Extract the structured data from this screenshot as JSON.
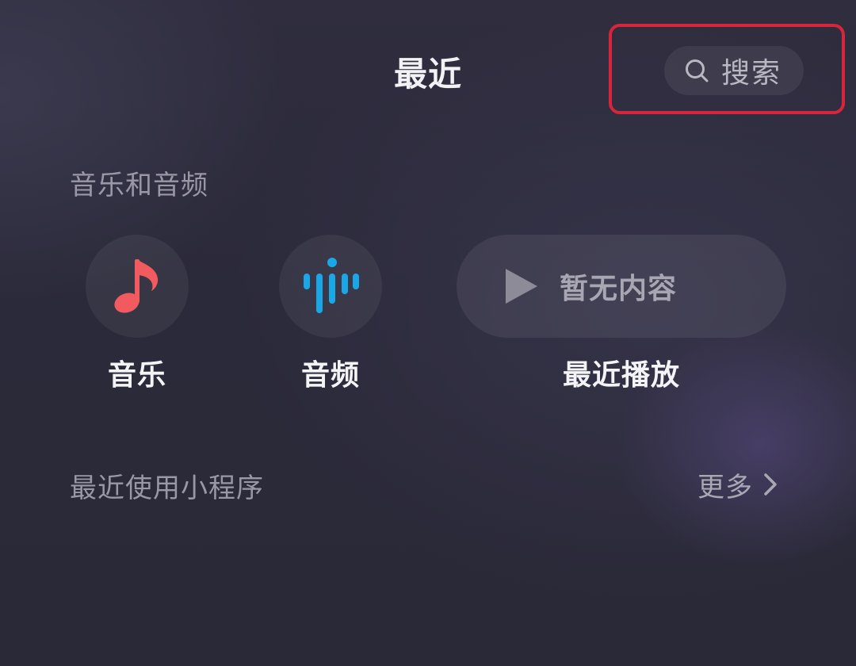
{
  "header": {
    "title": "最近",
    "search_label": "搜索",
    "search_icon": "search-icon"
  },
  "music_section": {
    "title": "音乐和音频",
    "tiles": [
      {
        "label": "音乐",
        "icon": "music-note-icon",
        "color": "#f15a5f"
      },
      {
        "label": "音频",
        "icon": "audio-wave-icon",
        "color": "#1aa7e8"
      }
    ],
    "recent": {
      "label": "最近播放",
      "empty_text": "暂无内容",
      "icon": "play-icon"
    }
  },
  "mini_programs": {
    "title": "最近使用小程序",
    "more_label": "更多",
    "more_icon": "chevron-right-icon"
  },
  "colors": {
    "highlight": "#d9253b",
    "music_accent": "#f15a5f",
    "audio_accent": "#1aa7e8"
  }
}
